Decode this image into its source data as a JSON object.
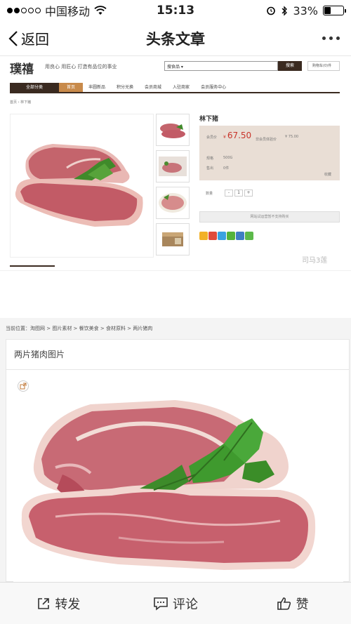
{
  "status_bar": {
    "carrier": "中国移动",
    "time": "15:13",
    "battery": "33%",
    "battery_level": 0.33
  },
  "nav": {
    "back_label": "返回",
    "title": "头条文章"
  },
  "shop": {
    "logo": "璞禧",
    "logo_sub": "PUXITOR",
    "slogan": "用良心 用匠心 打造有品位的事业",
    "search_select": "搜食品 ▾",
    "search_button": "搜索",
    "cart_label": "购物车(0)件",
    "menu": [
      "全部分类",
      "首页",
      "丰圆新品",
      "积分兑换",
      "会员商城",
      "入驻商家",
      "会员服务中心"
    ],
    "breadcrumb": "首页 › 林下猪",
    "product_name": "林下猪",
    "member_price_label": "会员价",
    "member_price": "67.50",
    "non_member_label": "非会员体验价",
    "non_member_price": "¥ 75.00",
    "spec_label": "规格",
    "spec_value": "500G",
    "sold_label": "售出",
    "sold_value": "0件",
    "favorite_label": "收藏",
    "qty_label": "数量",
    "qty_minus": "-",
    "qty_value": "1",
    "qty_plus": "+",
    "warn_button": "网站试运营暂不支持购买",
    "watermark": "司马3莲"
  },
  "gallery": {
    "breadcrumb": "当前位置：淘图网 > 图片素材 > 餐饮美食 > 食材原料 > 两片猪肉",
    "title": "两片猪肉图片"
  },
  "toolbar": {
    "forward": "转发",
    "comment": "评论",
    "like": "赞"
  }
}
